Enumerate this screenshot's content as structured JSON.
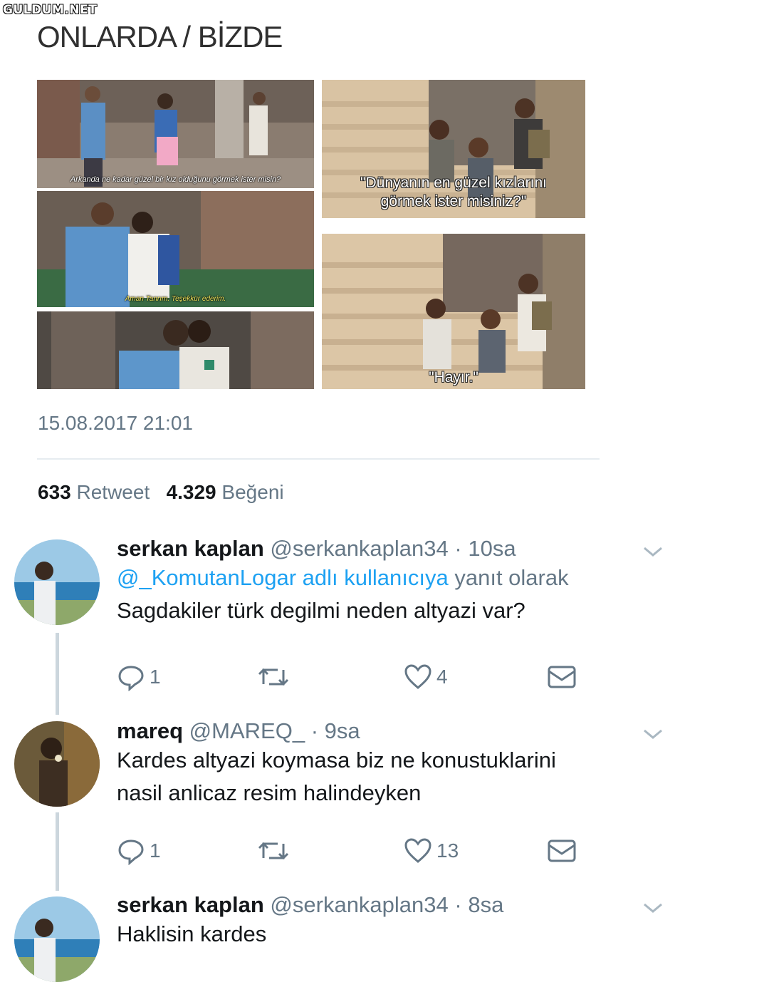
{
  "watermark": "GULDUM.NET",
  "tweet": {
    "text": "ONLARDA / BİZDE",
    "timestamp": "15.08.2017 21:01",
    "retweet_count": "633",
    "retweet_label": "Retweet",
    "like_count": "4.329",
    "like_label": "Beğeni"
  },
  "photos": {
    "left_top_subtitle": "Arkanda ne kadar güzel bir kız olduğunu görmek ister misin?",
    "left_mid_subtitle": "Aman Tanrım. Teşekkür ederim.",
    "right_top_subtitle_1": "\"Dünyanın en güzel kızlarını",
    "right_top_subtitle_2": "görmek ister misiniz?\"",
    "right_bottom_subtitle": "\"Hayır.\""
  },
  "replies": [
    {
      "name": "serkan kaplan",
      "handle": "@serkankaplan34",
      "time": "· 10sa",
      "reply_to_mention": "@_KomutanLogar adlı kullanıcıya",
      "reply_to_suffix": " yanıt olarak",
      "text": "Sagdakiler türk degilmi neden altyazi var?",
      "reply_count": "1",
      "retweet_count": "",
      "like_count": "4"
    },
    {
      "name": "mareq",
      "handle": "@MAREQ_",
      "time": "· 9sa",
      "text_line1": "Kardes altyazi koymasa biz ne konustuklarini",
      "text_line2": "nasil anlicaz resim halindeyken",
      "reply_count": "1",
      "retweet_count": "",
      "like_count": "13"
    },
    {
      "name": "serkan kaplan",
      "handle": "@serkankaplan34",
      "time": "· 8sa",
      "text": "Haklisin kardes"
    }
  ],
  "icons": [
    "reply-icon",
    "retweet-icon",
    "like-icon",
    "dm-icon",
    "chevron-down-icon"
  ]
}
